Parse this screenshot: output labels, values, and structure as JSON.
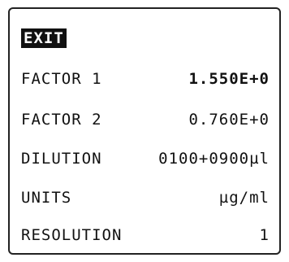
{
  "menu": {
    "exit_label": "EXIT"
  },
  "settings": [
    {
      "label": "FACTOR 1",
      "value": "1.550E+0"
    },
    {
      "label": "FACTOR 2",
      "value": "0.760E+0"
    },
    {
      "label": "DILUTION",
      "value": "0100+0900µl"
    },
    {
      "label": "UNITS",
      "value": "µg/ml"
    },
    {
      "label": "RESOLUTION",
      "value": "1"
    }
  ],
  "colors": {
    "foreground": "#111111",
    "background": "#ffffff"
  }
}
